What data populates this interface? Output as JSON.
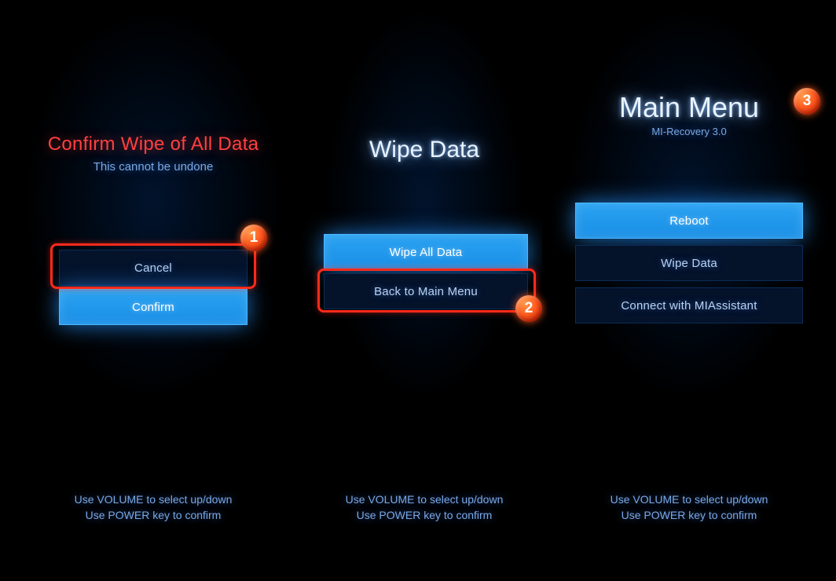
{
  "screens": [
    {
      "title": "Confirm Wipe of All Data",
      "subtitle": "This cannot be undone",
      "buttons": {
        "cancel": {
          "label": "Cancel",
          "selected": false,
          "highlighted": true
        },
        "confirm": {
          "label": "Confirm",
          "selected": true
        }
      },
      "footer": {
        "line1": "Use VOLUME to select up/down",
        "line2": "Use POWER key to confirm"
      },
      "marker": "1"
    },
    {
      "title": "Wipe Data",
      "buttons": {
        "wipe_all": {
          "label": "Wipe All Data",
          "selected": true
        },
        "back": {
          "label": "Back to Main Menu",
          "selected": false,
          "highlighted": true
        }
      },
      "footer": {
        "line1": "Use VOLUME to select up/down",
        "line2": "Use POWER key to confirm"
      },
      "marker": "2"
    },
    {
      "title": "Main Menu",
      "subtitle": "MI-Recovery 3.0",
      "buttons": {
        "reboot": {
          "label": "Reboot",
          "selected": true
        },
        "wipe": {
          "label": "Wipe Data",
          "selected": false
        },
        "assist": {
          "label": "Connect with MIAssistant",
          "selected": false
        }
      },
      "footer": {
        "line1": "Use VOLUME to select up/down",
        "line2": "Use POWER key to confirm"
      },
      "marker": "3"
    }
  ]
}
